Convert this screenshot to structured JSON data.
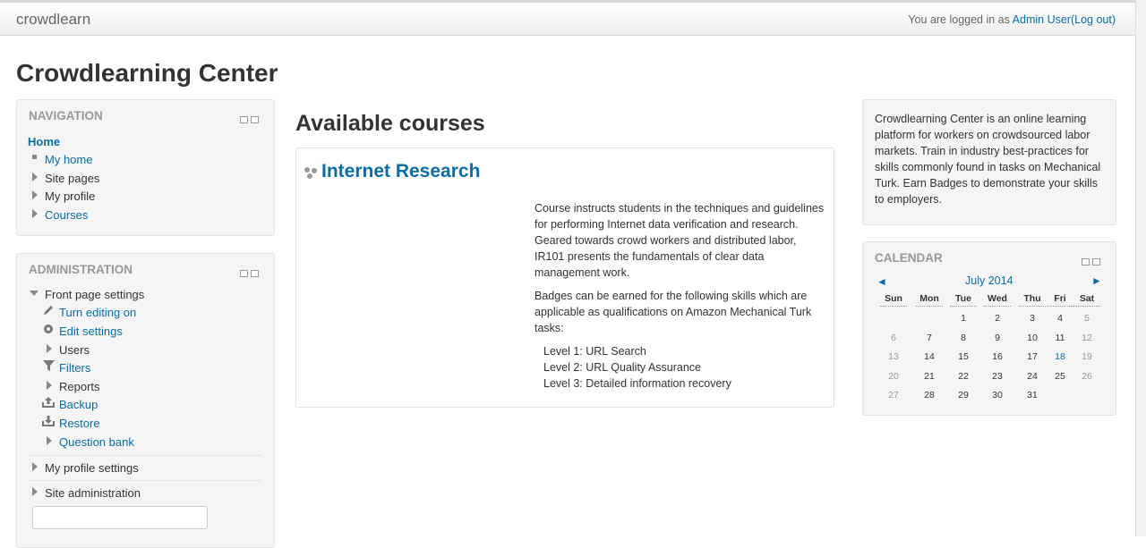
{
  "header": {
    "brand": "crowdlearn",
    "login_prefix": "You are logged in as ",
    "user": "Admin User",
    "logout": "(Log out)"
  },
  "page_title": "Crowdlearning Center",
  "navigation": {
    "title": "NAVIGATION",
    "home": "Home",
    "items": [
      "My home",
      "Site pages",
      "My profile",
      "Courses"
    ]
  },
  "administration": {
    "title": "ADMINISTRATION",
    "front_page_settings": "Front page settings",
    "items": [
      "Turn editing on",
      "Edit settings",
      "Users",
      "Filters",
      "Reports",
      "Backup",
      "Restore",
      "Question bank"
    ],
    "my_profile_settings": "My profile settings",
    "site_administration": "Site administration",
    "search_placeholder": ""
  },
  "main": {
    "heading": "Available courses",
    "course": {
      "title": "Internet Research",
      "description": "Course instructs students in the techniques and guidelines for performing Internet data verification and research. Geared towards crowd workers and distributed labor, IR101 presents the fundamentals of clear data management work.",
      "badges_intro": "Badges can be earned for the following skills which are applicable as qualifications on Amazon Mechanical Turk tasks:",
      "levels": [
        "Level 1: URL Search",
        "Level 2: URL Quality Assurance",
        "Level 3: Detailed information recovery"
      ]
    }
  },
  "about": {
    "text": "Crowdlearning Center is an online learning platform for workers on crowdsourced labor markets. Train in industry best-practices for skills commonly found in tasks on Mechanical Turk.  Earn Badges to demonstrate your skills to employers."
  },
  "calendar": {
    "title": "CALENDAR",
    "month": "July 2014",
    "prev": "◄",
    "next": "►",
    "weekdays": [
      "Sun",
      "Mon",
      "Tue",
      "Wed",
      "Thu",
      "Fri",
      "Sat"
    ],
    "weeks": [
      [
        "",
        "",
        "1",
        "2",
        "3",
        "4",
        "5"
      ],
      [
        "6",
        "7",
        "8",
        "9",
        "10",
        "11",
        "12"
      ],
      [
        "13",
        "14",
        "15",
        "16",
        "17",
        "18",
        "19"
      ],
      [
        "20",
        "21",
        "22",
        "23",
        "24",
        "25",
        "26"
      ],
      [
        "27",
        "28",
        "29",
        "30",
        "31",
        "",
        ""
      ]
    ],
    "today": "18"
  },
  "colors": {
    "link": "#0b6da6",
    "block_bg": "#f5f5f5",
    "block_heading": "#999999"
  }
}
